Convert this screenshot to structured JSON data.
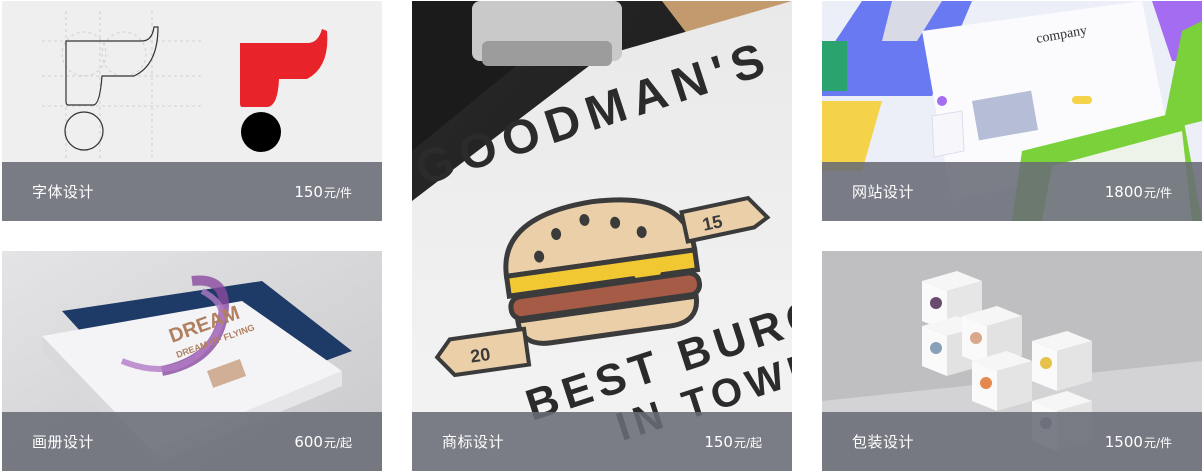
{
  "cards": [
    {
      "name": "字体设计",
      "price": "150",
      "unit": "元/件"
    },
    {
      "name": "商标设计",
      "price": "150",
      "unit": "元/起"
    },
    {
      "name": "网站设计",
      "price": "1800",
      "unit": "元/件"
    },
    {
      "name": "画册设计",
      "price": "600",
      "unit": "元/起"
    },
    {
      "name": "包装设计",
      "price": "1500",
      "unit": "元/件"
    }
  ],
  "artwork": {
    "burger_logo": {
      "top_text": "GOODMAN'S",
      "flag_left": "20",
      "flag_right": "15",
      "bottom_line_1": "BEST BURGER",
      "bottom_line_2": "IN TOWN"
    },
    "brochure_cover": {
      "headline": "DREAM",
      "subline": "DREAM OF FLYING"
    },
    "website_mock": {
      "heading": "company"
    }
  },
  "colors": {
    "overlay": "#696c75",
    "logo_red": "#e8232a",
    "burger_yellow": "#f2c832",
    "burger_bun": "#eacfa8",
    "website_blue": "#5b6cf0",
    "website_green": "#7ad13a"
  }
}
